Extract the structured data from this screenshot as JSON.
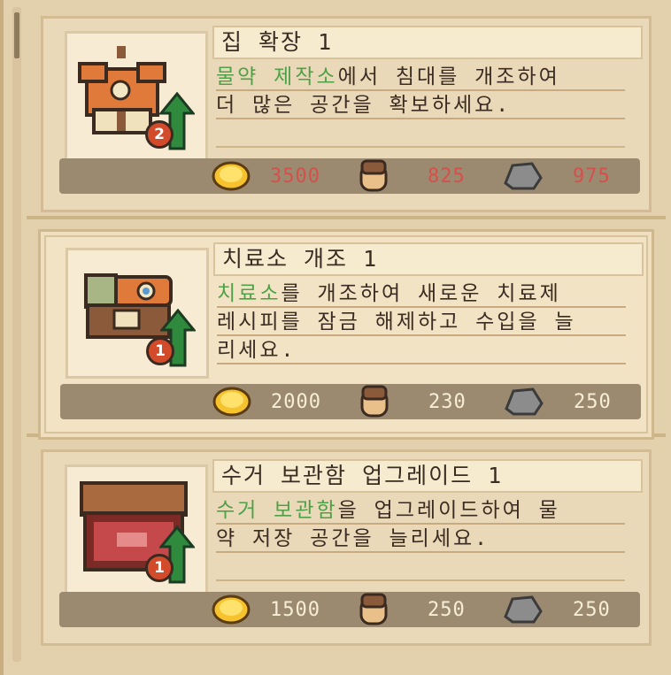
{
  "upgrades": [
    {
      "title": "집 확장 1",
      "desc_line1_highlight": "물약 제작소",
      "desc_line1_rest": "에서 침대를 개조하여",
      "desc_line2": "더 많은 공간을 확보하세요.",
      "desc_line3": "",
      "level_badge": "2",
      "icon": "house-icon",
      "costs": {
        "gold": "3500",
        "wood": "825",
        "stone": "975"
      },
      "affordable": false
    },
    {
      "title": "치료소 개조 1",
      "desc_line1_highlight": "치료소",
      "desc_line1_rest": "를 개조하여 새로운 치료제",
      "desc_line2": "레시피를 잠금 해제하고 수입을 늘",
      "desc_line3": "리세요.",
      "level_badge": "1",
      "icon": "clinic-icon",
      "costs": {
        "gold": "2000",
        "wood": "230",
        "stone": "250"
      },
      "affordable": true
    },
    {
      "title": "수거 보관함 업그레이드 1",
      "desc_line1_highlight": "수거 보관함",
      "desc_line1_rest": "을 업그레이드하여 물",
      "desc_line2": "약 저장 공간을 늘리세요.",
      "desc_line3": "",
      "level_badge": "1",
      "icon": "storage-chest-icon",
      "costs": {
        "gold": "1500",
        "wood": "250",
        "stone": "250"
      },
      "affordable": true
    }
  ],
  "colors": {
    "highlight": "#4ea148",
    "insufficient": "#d4504a",
    "cost_text": "#f6eed7",
    "badge": "#d24b2a",
    "arrow": "#2f8a3d"
  }
}
